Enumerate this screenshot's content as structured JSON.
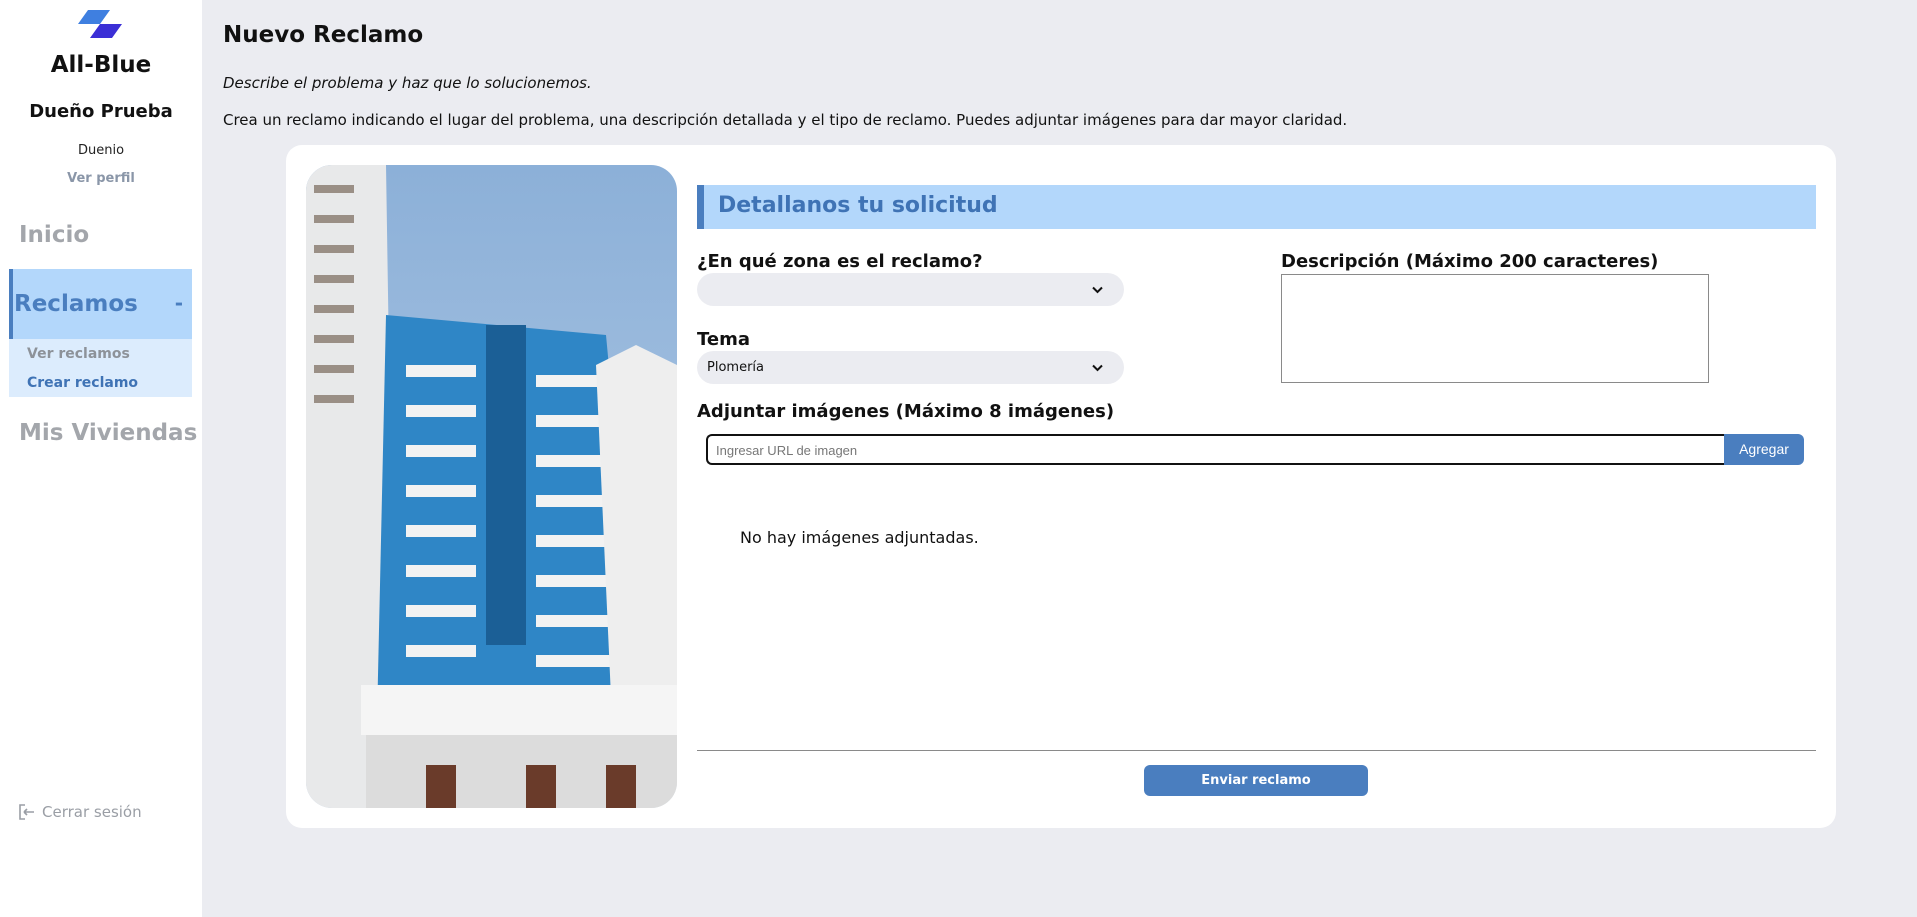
{
  "sidebar": {
    "brand": "All-Blue",
    "user_name": "Dueño Prueba",
    "user_role": "Duenio",
    "view_profile": "Ver perfil",
    "nav": {
      "inicio": "Inicio",
      "reclamos": "Reclamos",
      "reclamos_toggle": "-",
      "ver_reclamos": "Ver reclamos",
      "crear_reclamo": "Crear reclamo",
      "mis_viviendas": "Mis Viviendas"
    },
    "logout": "Cerrar sesión",
    "accent_color": "#4a7ebf",
    "highlight_color": "#b3d7fb"
  },
  "header": {
    "title": "Nuevo Reclamo",
    "subtitle": "Describe el problema y haz que lo solucionemos.",
    "description": "Crea un reclamo indicando el lugar del problema, una descripción detallada y el tipo de reclamo. Puedes adjuntar imágenes para dar mayor claridad."
  },
  "form": {
    "section_title": "Detallanos tu solicitud",
    "zona_label": "¿En qué zona es el reclamo?",
    "zona_value": "",
    "tema_label": "Tema",
    "tema_value": "Plomería",
    "descripcion_label": "Descripción (Máximo 200 caracteres)",
    "descripcion_value": "",
    "adjuntar_label": "Adjuntar imágenes (Máximo 8 imágenes)",
    "url_placeholder": "Ingresar URL de imagen",
    "add_button": "Agregar",
    "no_images": "No hay imágenes adjuntadas.",
    "submit_button": "Enviar reclamo"
  },
  "icons": {
    "logo": "all-blue-logo",
    "chevron": "chevron-down-icon",
    "logout": "logout-icon"
  }
}
